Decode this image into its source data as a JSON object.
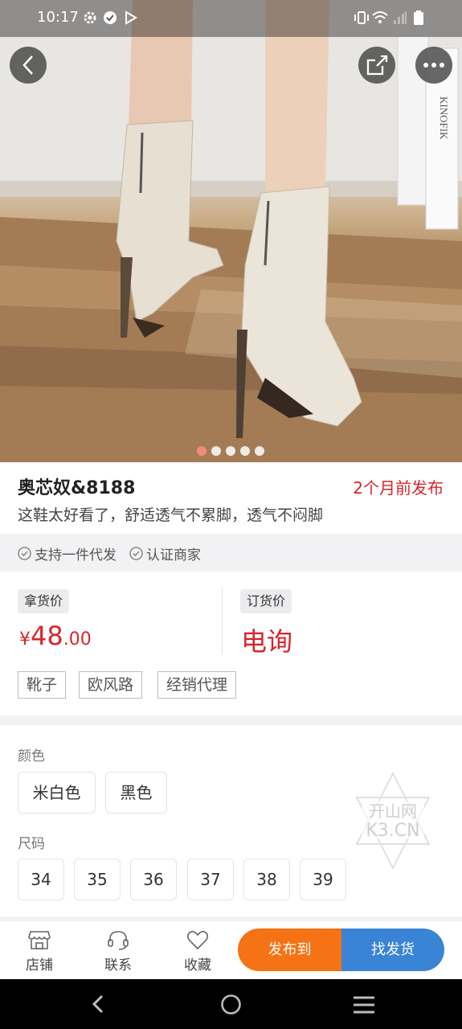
{
  "status_bar": {
    "time": "10:17",
    "left_icons": [
      "gear-icon",
      "check-circle-icon",
      "play-store-icon"
    ],
    "right_icons": [
      "vibrate-icon",
      "wifi-icon",
      "signal-icon",
      "battery-icon"
    ]
  },
  "hero": {
    "image": "beige-stiletto-ankle-boots-photo",
    "carousel_total": 5,
    "carousel_active": 1
  },
  "product": {
    "title": "奥芯奴&8188",
    "posted": "2个月前发布",
    "description": "这鞋太好看了，舒适透气不累脚，透气不闷脚"
  },
  "badges": [
    "支持一件代发",
    "认证商家"
  ],
  "pricing": {
    "pickup_label": "拿货价",
    "currency": "¥",
    "price_int": "48",
    "price_dec": ".00",
    "order_label": "订货价",
    "order_value": "电询"
  },
  "tags": [
    "靴子",
    "欧风路",
    "经销代理"
  ],
  "options": {
    "color_label": "颜色",
    "colors": [
      "米白色",
      "黑色"
    ],
    "size_label": "尺码",
    "sizes": [
      "34",
      "35",
      "36",
      "37",
      "38",
      "39"
    ]
  },
  "bottom_bar": {
    "shop": "店铺",
    "contact": "联系",
    "favorite": "收藏",
    "publish": "发布到",
    "find": "找发货"
  },
  "colors": {
    "accent_red": "#d8262c",
    "orange": "#f57215",
    "blue": "#3a84d6"
  }
}
